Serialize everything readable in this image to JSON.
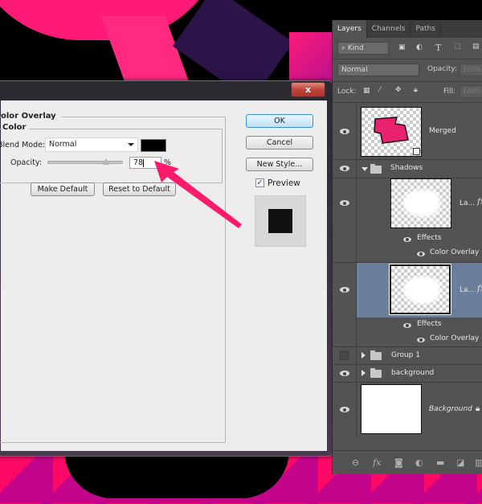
{
  "dialog": {
    "close_label": "x",
    "section_title": "olor Overlay",
    "group_title": "Color",
    "blend_mode_label": "Blend Mode:",
    "blend_mode_value": "Normal",
    "overlay_color": "#000000",
    "opacity_label": "Opacity:",
    "opacity_value": "78",
    "opacity_percent": 78,
    "percent_sign": "%",
    "make_default_label": "Make Default",
    "reset_default_label": "Reset to Default",
    "ok_label": "OK",
    "cancel_label": "Cancel",
    "new_style_label": "New Style...",
    "preview_label": "Preview",
    "preview_checked": true
  },
  "layers_panel": {
    "tabs": [
      "Layers",
      "Channels",
      "Paths"
    ],
    "active_tab": "Layers",
    "filter_label": "Kind",
    "blend_mode": "Normal",
    "opacity_label": "Opacity:",
    "opacity_value": "100%",
    "lock_label": "Lock:",
    "fill_label": "Fill:",
    "fill_value": "100%",
    "layers": [
      {
        "name": "Merged",
        "type": "smart-object",
        "visible": true
      },
      {
        "name": "Shadows",
        "type": "group",
        "expanded": true,
        "visible": true
      },
      {
        "name": "La...",
        "type": "layer",
        "visible": true,
        "fx": "fx",
        "effects_label": "Effects",
        "effect": "Color Overlay"
      },
      {
        "name": "La...",
        "type": "layer",
        "visible": true,
        "selected": true,
        "fx": "fx",
        "effects_label": "Effects",
        "effect": "Color Overlay"
      },
      {
        "name": "Group 1",
        "type": "group",
        "expanded": false,
        "visible": false
      },
      {
        "name": "background",
        "type": "group",
        "expanded": false,
        "visible": true
      },
      {
        "name": "Background",
        "type": "background",
        "visible": true,
        "locked": true
      }
    ],
    "footer_icons": [
      "link-icon",
      "fx-icon",
      "mask-icon",
      "adjustment-icon",
      "folder-icon",
      "new-layer-icon",
      "trash-icon"
    ]
  },
  "colors": {
    "annotation_arrow": "#ff1a6c",
    "selected_layer": "#6b7f9a"
  }
}
